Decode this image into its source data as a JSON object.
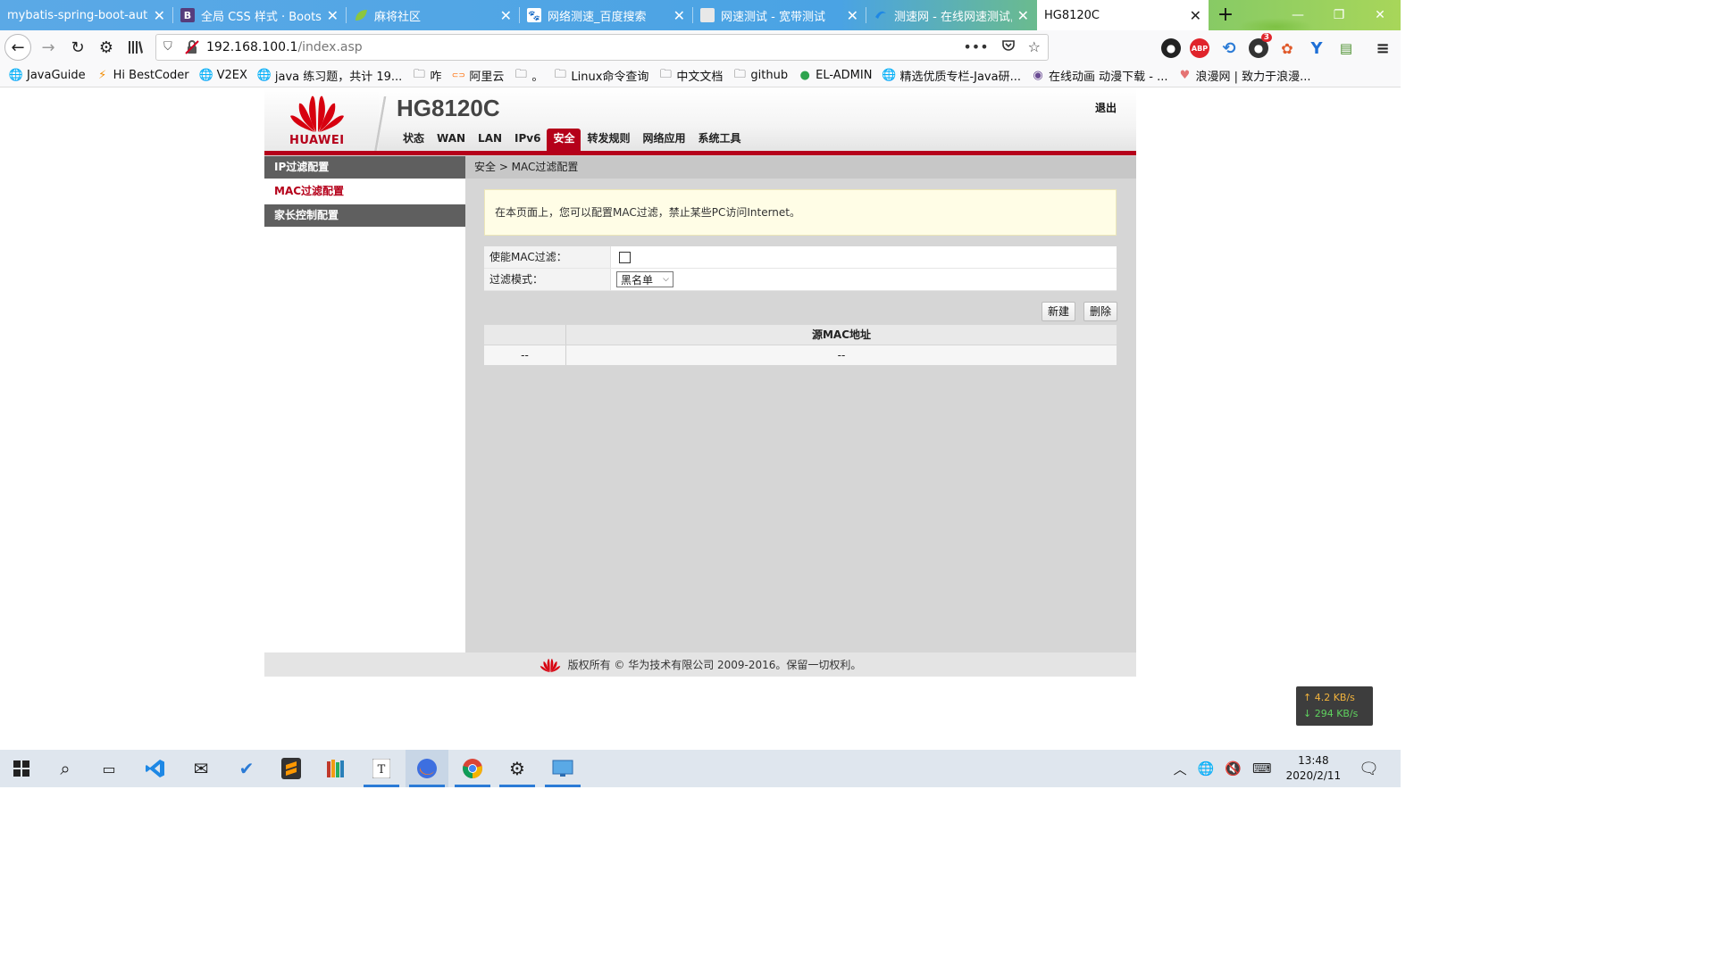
{
  "browser": {
    "tabs": [
      {
        "label": "mybatis-spring-boot-auto",
        "icon": "generic-page-icon",
        "icon_color": "#888888",
        "active": false
      },
      {
        "label": "全局 CSS 样式 · Bootstr",
        "icon": "bootstrap-icon",
        "icon_text": "B",
        "icon_color": "#563d7c",
        "active": false
      },
      {
        "label": "麻将社区",
        "icon": "leaf-icon",
        "icon_color": "#8cc63f",
        "active": false
      },
      {
        "label": "网络测速_百度搜索",
        "icon": "baidu-paw-icon",
        "icon_color": "#2932e1",
        "active": false
      },
      {
        "label": "网速测试 - 宽带测试",
        "icon": "generic-page-icon",
        "icon_color": "#cccccc",
        "active": false
      },
      {
        "label": "测速网 - 在线网速测试,网",
        "icon": "speedtest-icon",
        "icon_color": "#1e88e5",
        "active": false
      },
      {
        "label": "HG8120C",
        "icon": "none",
        "icon_color": "#ffffff",
        "active": true
      }
    ],
    "url": {
      "host": "192.168.100.1",
      "path": "/index.asp"
    },
    "bookmarks": [
      {
        "label": "JavaGuide",
        "icon": "globe-icon"
      },
      {
        "label": "Hi BestCoder",
        "icon": "bestcoder-icon"
      },
      {
        "label": "V2EX",
        "icon": "globe-icon"
      },
      {
        "label": "java 练习题，共计 19...",
        "icon": "globe-icon"
      },
      {
        "label": "咋",
        "icon": "folder-icon"
      },
      {
        "label": "阿里云",
        "icon": "aliyun-icon"
      },
      {
        "label": "。",
        "icon": "folder-icon"
      },
      {
        "label": "Linux命令查询",
        "icon": "folder-icon"
      },
      {
        "label": "中文文档",
        "icon": "folder-icon"
      },
      {
        "label": "github",
        "icon": "folder-icon"
      },
      {
        "label": "EL-ADMIN",
        "icon": "el-admin-icon"
      },
      {
        "label": "精选优质专栏-Java研...",
        "icon": "globe-icon"
      },
      {
        "label": "在线动画 动漫下载 - ...",
        "icon": "anime-avatar-icon"
      },
      {
        "label": "浪漫网 | 致力于浪漫...",
        "icon": "romance-icon"
      }
    ],
    "extension_badge": "3"
  },
  "router": {
    "brand": "HUAWEI",
    "model": "HG8120C",
    "logout": "退出",
    "nav": [
      "状态",
      "WAN",
      "LAN",
      "IPv6",
      "安全",
      "转发规则",
      "网络应用",
      "系统工具"
    ],
    "nav_active": "安全",
    "sidebar": [
      "IP过滤配置",
      "MAC过滤配置",
      "家长控制配置"
    ],
    "sidebar_active": "MAC过滤配置",
    "breadcrumb": "安全 > MAC过滤配置",
    "note": "在本页面上，您可以配置MAC过滤，禁止某些PC访问Internet。",
    "form": {
      "enable_label": "使能MAC过滤：",
      "enable_checked": false,
      "mode_label": "过滤模式：",
      "mode_value": "黑名单"
    },
    "buttons": {
      "new": "新建",
      "delete": "删除"
    },
    "table": {
      "headers": [
        "",
        "源MAC地址"
      ],
      "rows": [
        [
          "--",
          "--"
        ]
      ]
    },
    "footer": "版权所有 © 华为技术有限公司 2009-2016。保留一切权利。",
    "brand_color": "#b5001a"
  },
  "speed_widget": {
    "up": "↑ 4.2 KB/s",
    "down": "↓ 294 KB/s"
  },
  "taskbar": {
    "apps": [
      "start-icon",
      "search-icon",
      "task-view-icon",
      "vscode-icon",
      "mail-icon",
      "todo-icon",
      "sublime-icon",
      "books-icon",
      "typora-icon",
      "firefox-icon",
      "chrome-icon",
      "settings-icon",
      "remote-desktop-icon"
    ],
    "time": "13:48",
    "date": "2020/2/11"
  }
}
